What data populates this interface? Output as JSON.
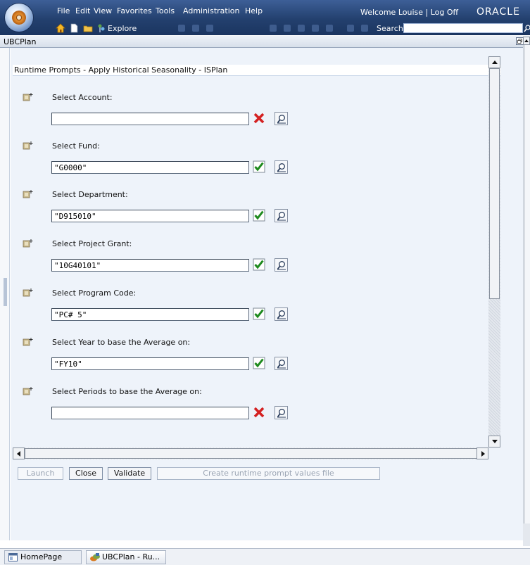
{
  "menu": {
    "file": "File",
    "edit": "Edit",
    "view": "View",
    "favorites": "Favorites",
    "tools": "Tools",
    "administration": "Administration",
    "help": "Help"
  },
  "header": {
    "welcome": "Welcome  Louise  |  Log Off",
    "brand": "ORACLE"
  },
  "toolbar": {
    "explore_label": "Explore",
    "search_label": "Search",
    "search_value": ""
  },
  "tab": {
    "title": "UBCPlan"
  },
  "dialog": {
    "title": "Runtime Prompts - Apply Historical Seasonality - ISPlan"
  },
  "prompts": [
    {
      "label": "Select Account:",
      "value": "",
      "status": "invalid"
    },
    {
      "label": "Select Fund:",
      "value": "\"G0000\"",
      "status": "valid"
    },
    {
      "label": "Select Department:",
      "value": "\"D915010\"",
      "status": "valid"
    },
    {
      "label": "Select Project Grant:",
      "value": "\"10G40101\"",
      "status": "valid"
    },
    {
      "label": "Select Program Code:",
      "value": "\"PC# 5\"",
      "status": "valid"
    },
    {
      "label": "Select Year to base the Average on:",
      "value": "\"FY10\"",
      "status": "valid"
    },
    {
      "label": "Select Periods to base the Average on:",
      "value": "",
      "status": "invalid"
    }
  ],
  "buttons": {
    "launch": "Launch",
    "close": "Close",
    "validate": "Validate",
    "create_file": "Create runtime prompt values file"
  },
  "taskbar": {
    "home": "HomePage",
    "ubcplan": "UBCPlan - Ru..."
  },
  "colors": {
    "header_bg": "#23406e",
    "panel_bg": "#eef3fa",
    "valid": "#1e8a1e",
    "invalid": "#d42020"
  }
}
